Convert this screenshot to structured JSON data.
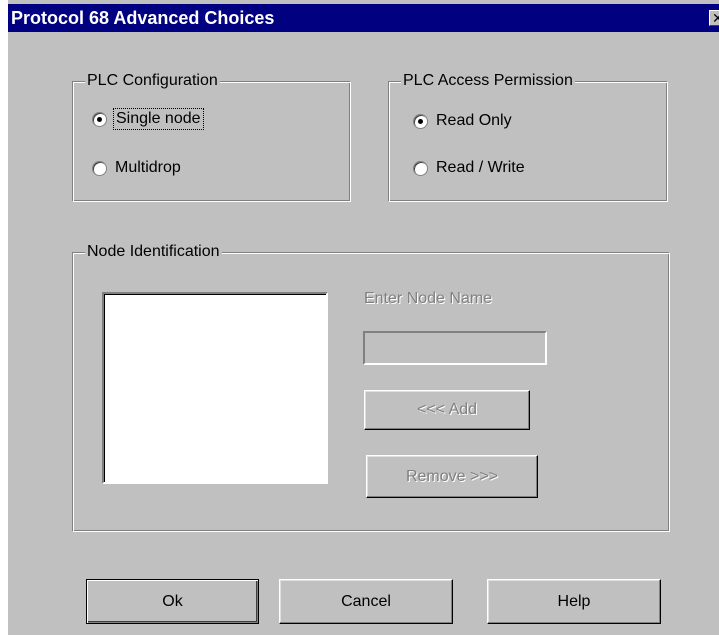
{
  "window": {
    "title": "Protocol 68 Advanced Choices",
    "close_glyph": "✕"
  },
  "plc_configuration": {
    "label": "PLC Configuration",
    "options": [
      {
        "label": "Single node",
        "checked": true,
        "focused": true
      },
      {
        "label": "Multidrop",
        "checked": false
      }
    ]
  },
  "plc_access_permission": {
    "label": "PLC Access Permission",
    "options": [
      {
        "label": "Read Only",
        "checked": true
      },
      {
        "label": "Read / Write",
        "checked": false
      }
    ]
  },
  "node_identification": {
    "label": "Node Identification",
    "enter_node_name_label": "Enter Node Name",
    "node_name_value": "",
    "add_label": "<<< Add",
    "remove_label": "Remove >>>",
    "node_list": []
  },
  "footer": {
    "ok_label": "Ok",
    "cancel_label": "Cancel",
    "help_label": "Help"
  },
  "colors": {
    "dialog_background": "#c0c0c0",
    "title_bar": "#000080",
    "disabled_text": "#808080"
  }
}
